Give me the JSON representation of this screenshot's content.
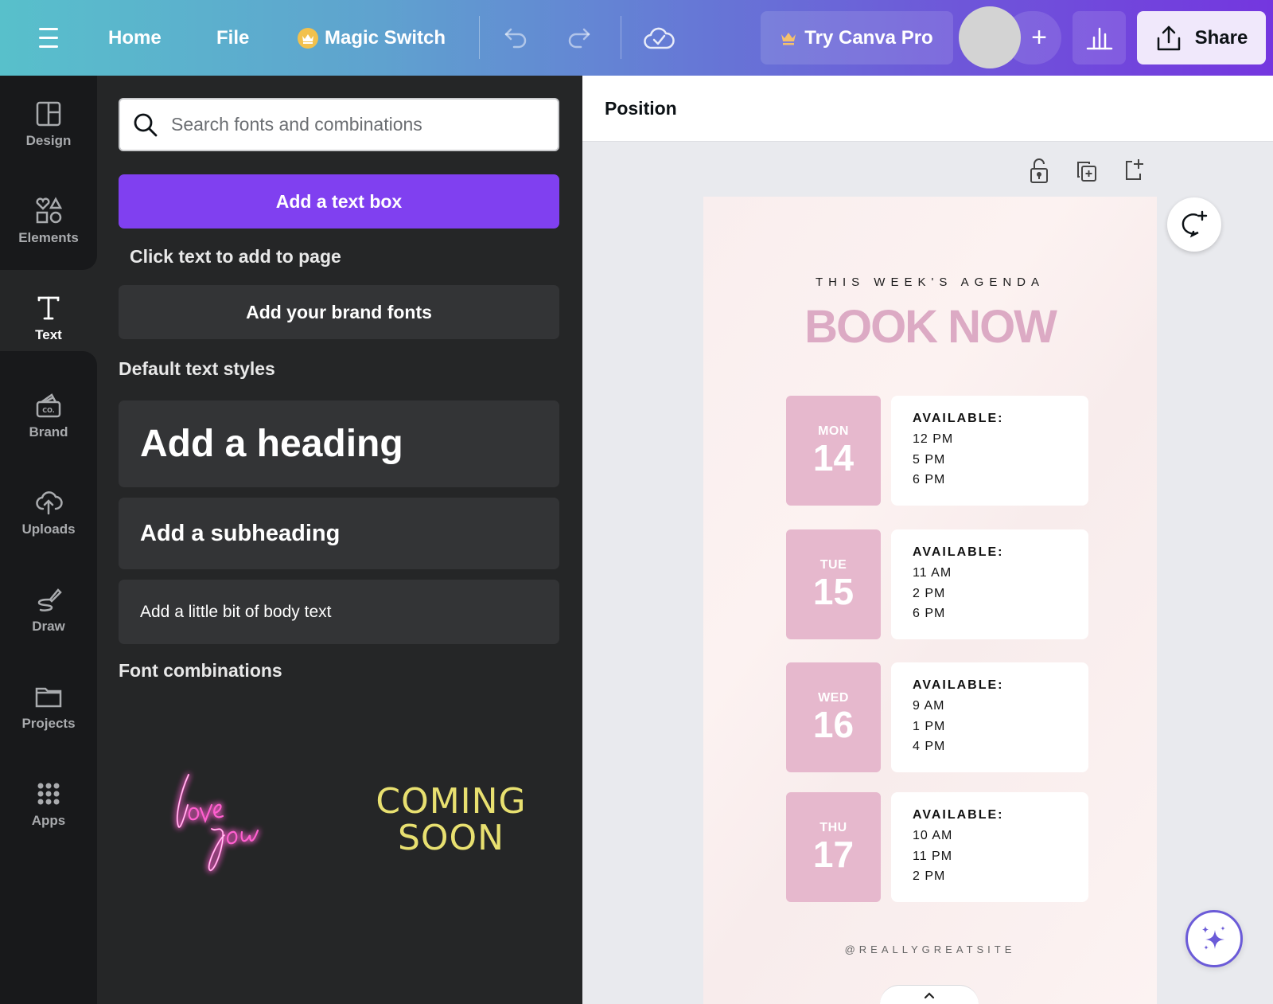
{
  "topbar": {
    "menu_icon": "hamburger-menu-icon",
    "home": "Home",
    "file": "File",
    "magic_switch": "Magic Switch",
    "magic_icon": "crown-icon",
    "undo_icon": "undo-icon",
    "redo_icon": "redo-icon",
    "save_status_icon": "cloud-check-icon",
    "try_pro": "Try Canva Pro",
    "plus": "+",
    "insights_icon": "bar-chart-icon",
    "share": "Share",
    "share_icon": "upload-icon"
  },
  "rail": {
    "items": [
      {
        "label": "Design",
        "icon": "layout-icon"
      },
      {
        "label": "Elements",
        "icon": "shapes-icon"
      },
      {
        "label": "Text",
        "icon": "text-icon",
        "active": true
      },
      {
        "label": "Brand",
        "icon": "brand-kit-icon"
      },
      {
        "label": "Uploads",
        "icon": "cloud-upload-icon"
      },
      {
        "label": "Draw",
        "icon": "draw-pen-icon"
      },
      {
        "label": "Projects",
        "icon": "folder-icon"
      },
      {
        "label": "Apps",
        "icon": "apps-grid-icon"
      }
    ]
  },
  "panel": {
    "search_placeholder": "Search fonts and combinations",
    "search_value": "",
    "add_text_box": "Add a text box",
    "hint": "Click text to add to page",
    "brand_fonts": "Add your brand fonts",
    "default_styles_title": "Default text styles",
    "heading": "Add a heading",
    "subheading": "Add a subheading",
    "body": "Add a little bit of body text",
    "combinations_title": "Font combinations",
    "combinations": [
      {
        "line1": "love",
        "line2": "you",
        "color": "#ff4fc8"
      },
      {
        "line1": "COMING",
        "line2": "SOON",
        "color": "#e8e070"
      }
    ]
  },
  "canvas": {
    "toolbar_label": "Position",
    "page_tools": [
      "lock-icon",
      "duplicate-page-icon",
      "add-page-icon"
    ],
    "comment_icon": "add-comment-icon",
    "magic_icon": "sparkles-icon",
    "expand_icon": "chevron-up-icon",
    "collapse_icon": "chevron-left-icon"
  },
  "design": {
    "kicker": "THIS WEEK'S AGENDA",
    "title": "BOOK NOW",
    "title_color": "#dcaac4",
    "day_color": "#e6b8cd",
    "available_label": "AVAILABLE:",
    "days": [
      {
        "name": "MON",
        "num": "14",
        "times": [
          "12 PM",
          "5 PM",
          "6 PM"
        ]
      },
      {
        "name": "TUE",
        "num": "15",
        "times": [
          "11 AM",
          "2 PM",
          "6 PM"
        ]
      },
      {
        "name": "WED",
        "num": "16",
        "times": [
          "9 AM",
          "1 PM",
          "4 PM"
        ]
      },
      {
        "name": "THU",
        "num": "17",
        "times": [
          "10 AM",
          "11 PM",
          "2 PM"
        ]
      }
    ],
    "handle": "@REALLYGREATSITE"
  },
  "colors": {
    "accent_purple": "#8040f0",
    "panel_bg": "#252627",
    "rail_bg": "#18191b"
  }
}
